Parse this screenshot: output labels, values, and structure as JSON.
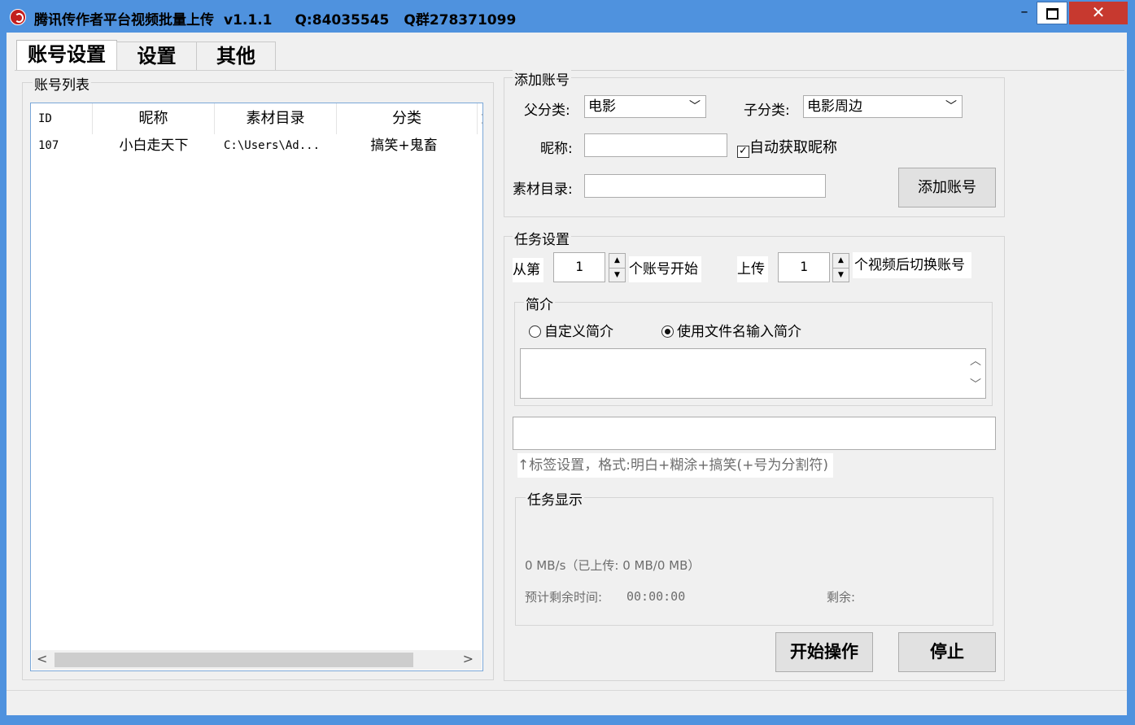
{
  "window": {
    "title": "腾讯传作者平台视频批量上传",
    "version": "v1.1.1",
    "qq": "Q:84035545",
    "qq_group": "Q群278371099",
    "minimize": "–",
    "close": "✕"
  },
  "tabs": [
    {
      "label": "账号设置",
      "active": true
    },
    {
      "label": "设置",
      "active": false
    },
    {
      "label": "其他",
      "active": false
    }
  ],
  "account_list": {
    "group_label": "账号列表",
    "columns": [
      "ID",
      "昵称",
      "素材目录",
      "分类",
      "]"
    ],
    "rows": [
      {
        "id": "107",
        "nickname": "小白走天下",
        "dir": "C:\\Users\\Ad...",
        "category": "搞笑+鬼畜"
      }
    ],
    "scroll_left": "<",
    "scroll_right": ">"
  },
  "add_account": {
    "group_label": "添加账号",
    "parent_category_label": "父分类:",
    "parent_category_value": "电影",
    "sub_category_label": "子分类:",
    "sub_category_value": "电影周边",
    "nickname_label": "昵称:",
    "nickname_value": "",
    "auto_nickname_label": "自动获取昵称",
    "auto_nickname_checked": true,
    "material_dir_label": "素材目录:",
    "material_dir_value": "",
    "add_button": "添加账号"
  },
  "task_settings": {
    "group_label": "任务设置",
    "from_label": "从第",
    "from_value": "1",
    "account_start_label": "个账号开始",
    "upload_label": "上传",
    "upload_value": "1",
    "switch_label": "个视频后切换账号",
    "intro": {
      "group_label": "简介",
      "custom_label": "自定义简介",
      "filename_label": "使用文件名输入简介",
      "selected": "filename",
      "text": ""
    },
    "tags_value": "",
    "tags_hint": "↑标签设置，格式:明白+糊涂+搞笑(+号为分割符)"
  },
  "task_display": {
    "group_label": "任务显示",
    "speed": "0 MB/s（已上传: 0 MB/0 MB）",
    "eta_label": "预计剩余时间:",
    "eta_value": "00:00:00",
    "remaining_label": "剩余:"
  },
  "actions": {
    "start": "开始操作",
    "stop": "停止"
  }
}
